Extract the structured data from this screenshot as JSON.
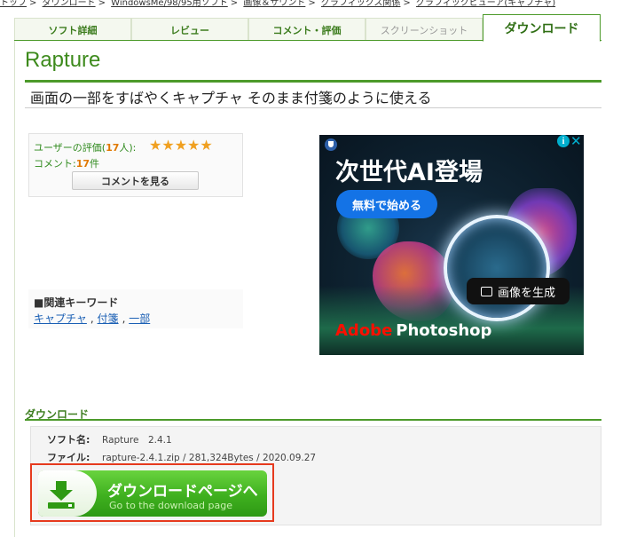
{
  "breadcrumb": [
    "トップ",
    "ダウンロード",
    "WindowsMe/98/95用ソフト",
    "画像＆サウンド",
    "グラフィックス関係",
    "グラフィックビューア(キャプチャ)"
  ],
  "tabs": [
    {
      "label": "ソフト詳細",
      "state": "normal"
    },
    {
      "label": "レビュー",
      "state": "normal"
    },
    {
      "label": "コメント・評価",
      "state": "normal"
    },
    {
      "label": "スクリーンショット",
      "state": "disabled"
    },
    {
      "label": "ダウンロード",
      "state": "active"
    }
  ],
  "app": {
    "title": "Rapture",
    "tagline": "画面の一部をすばやくキャプチャ そのまま付箋のように使える"
  },
  "rating": {
    "label_prefix": "ユーザーの評価(",
    "count": "17",
    "label_suffix": "人):",
    "stars": "★★★★★",
    "stars_value": 5,
    "comment_prefix": "コメント:",
    "comment_count": "17",
    "comment_suffix": "件",
    "see_comments_button": "コメントを見る"
  },
  "keywords": {
    "heading": "■関連キーワード",
    "items": [
      "キャプチャ",
      "付箋",
      "一部"
    ]
  },
  "ad": {
    "headline": "次世代AI登場",
    "cta": "無料で始める",
    "generate_button": "画像を生成",
    "brand_adobe": "Adobe",
    "brand_product": "Photoshop",
    "info": "i",
    "close": "✕"
  },
  "download": {
    "heading": "ダウンロード",
    "software_name_label": "ソフト名:",
    "software_name_value": "Rapture　2.4.1",
    "file_label": "ファイル:",
    "file_value": "rapture-2.4.1.zip / 281,324Bytes / 2020.09.27",
    "button_label": "ダウンロードページへ",
    "button_sublabel": "Go to the download page",
    "accent_color": "#3fb01f",
    "highlight_color": "#e63a1e"
  }
}
